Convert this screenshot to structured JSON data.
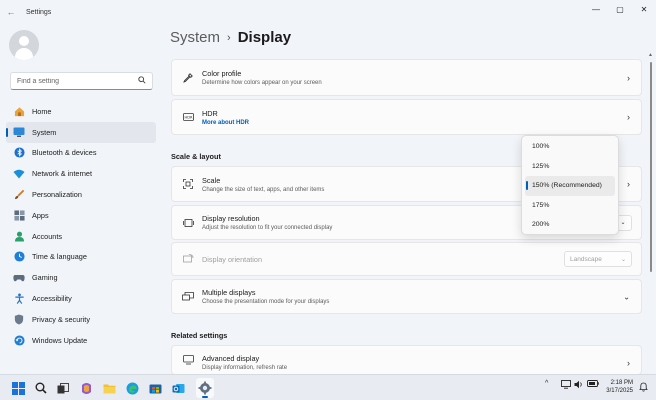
{
  "window": {
    "title": "Settings",
    "back_glyph": "←",
    "minimize_glyph": "—",
    "maximize_glyph": "▢",
    "close_glyph": "✕"
  },
  "search": {
    "placeholder": "Find a setting",
    "icon": "search-icon"
  },
  "sidebar": {
    "items": [
      {
        "label": "Home",
        "icon": "home-icon",
        "active": false
      },
      {
        "label": "System",
        "icon": "monitor-icon",
        "active": true
      },
      {
        "label": "Bluetooth & devices",
        "icon": "bluetooth-icon",
        "active": false
      },
      {
        "label": "Network & internet",
        "icon": "wifi-icon",
        "active": false
      },
      {
        "label": "Personalization",
        "icon": "brush-icon",
        "active": false
      },
      {
        "label": "Apps",
        "icon": "apps-icon",
        "active": false
      },
      {
        "label": "Accounts",
        "icon": "person-icon",
        "active": false
      },
      {
        "label": "Time & language",
        "icon": "globe-clock-icon",
        "active": false
      },
      {
        "label": "Gaming",
        "icon": "controller-icon",
        "active": false
      },
      {
        "label": "Accessibility",
        "icon": "accessibility-icon",
        "active": false
      },
      {
        "label": "Privacy & security",
        "icon": "shield-icon",
        "active": false
      },
      {
        "label": "Windows Update",
        "icon": "update-icon",
        "active": false
      }
    ]
  },
  "breadcrumb": {
    "parent": "System",
    "separator": "›",
    "current": "Display"
  },
  "settings": {
    "color_profile": {
      "title": "Color profile",
      "subtitle": "Determine how colors appear on your screen"
    },
    "hdr": {
      "title": "HDR",
      "link": "More about HDR"
    },
    "scale_layout_header": "Scale & layout",
    "scale": {
      "title": "Scale",
      "subtitle": "Change the size of text, apps, and other items"
    },
    "resolution": {
      "title": "Display resolution",
      "subtitle": "Adjust the resolution to fit your connected display"
    },
    "orientation": {
      "title": "Display orientation",
      "value": "Landscape"
    },
    "multiple": {
      "title": "Multiple displays",
      "subtitle": "Choose the presentation mode for your displays"
    },
    "related_header": "Related settings",
    "advanced": {
      "title": "Advanced display",
      "subtitle": "Display information, refresh rate"
    }
  },
  "scale_flyout": {
    "options": [
      "100%",
      "125%",
      "150% (Recommended)",
      "175%",
      "200%"
    ],
    "selected_index": 2
  },
  "taskbar": {
    "time": "2:18 PM",
    "date": "3/17/2025",
    "tray_chevron": "^"
  },
  "colors": {
    "accent": "#005fb8",
    "background": "#f1f4f8",
    "card": "#fbfbfb"
  }
}
